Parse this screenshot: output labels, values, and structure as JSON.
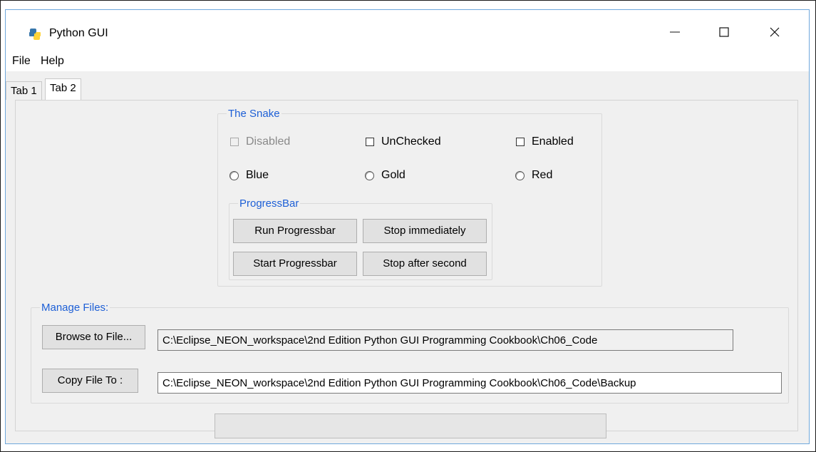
{
  "window": {
    "title": "Python GUI",
    "icon": "python-icon"
  },
  "menu": {
    "file": "File",
    "help": "Help"
  },
  "tabs": [
    {
      "label": "Tab 1",
      "active": false
    },
    {
      "label": "Tab 2",
      "active": true
    }
  ],
  "snake": {
    "legend": "The Snake",
    "checkboxes": [
      {
        "label": "Disabled",
        "checked": false,
        "disabled": true
      },
      {
        "label": "UnChecked",
        "checked": false,
        "disabled": false
      },
      {
        "label": "Enabled",
        "checked": false,
        "disabled": false
      }
    ],
    "radios": [
      {
        "label": "Blue",
        "selected": false
      },
      {
        "label": "Gold",
        "selected": false
      },
      {
        "label": "Red",
        "selected": false
      }
    ]
  },
  "progress_group": {
    "legend": "ProgressBar",
    "buttons": {
      "run": "Run Progressbar",
      "stop_now": "Stop immediately",
      "start": "Start Progressbar",
      "stop_after": "Stop after second"
    }
  },
  "manage_files": {
    "legend": "Manage Files:",
    "browse_label": "Browse to File...",
    "browse_path": "C:\\Eclipse_NEON_workspace\\2nd Edition Python GUI Programming Cookbook\\Ch06_Code",
    "copy_label": "Copy File To :",
    "copy_path": "C:\\Eclipse_NEON_workspace\\2nd Edition Python GUI Programming Cookbook\\Ch06_Code\\Backup"
  },
  "progress_bar": {
    "value_percent": 0
  },
  "colors": {
    "legend_text": "#1d5fd6",
    "window_bg": "#f0f0f0"
  }
}
